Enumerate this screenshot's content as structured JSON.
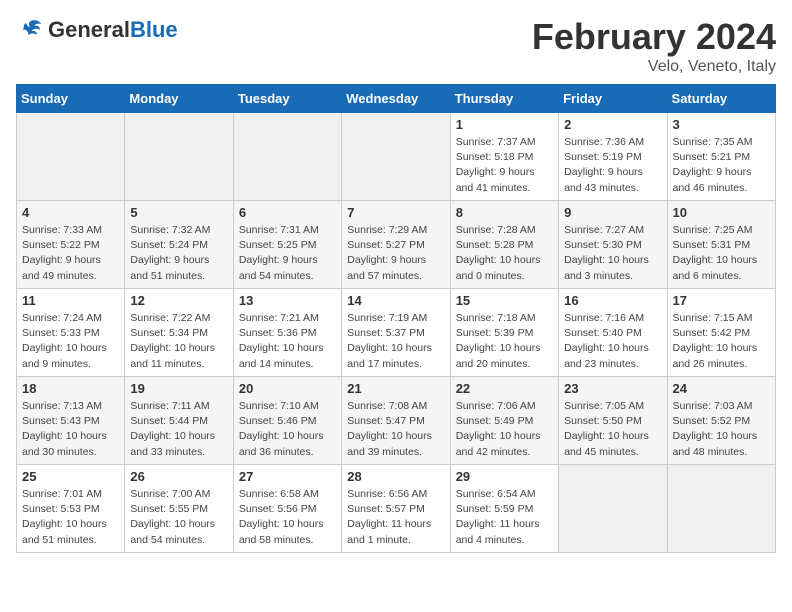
{
  "header": {
    "logo_general": "General",
    "logo_blue": "Blue",
    "month_title": "February 2024",
    "subtitle": "Velo, Veneto, Italy"
  },
  "days_of_week": [
    "Sunday",
    "Monday",
    "Tuesday",
    "Wednesday",
    "Thursday",
    "Friday",
    "Saturday"
  ],
  "weeks": [
    [
      {
        "day": "",
        "info": ""
      },
      {
        "day": "",
        "info": ""
      },
      {
        "day": "",
        "info": ""
      },
      {
        "day": "",
        "info": ""
      },
      {
        "day": "1",
        "info": "Sunrise: 7:37 AM\nSunset: 5:18 PM\nDaylight: 9 hours\nand 41 minutes."
      },
      {
        "day": "2",
        "info": "Sunrise: 7:36 AM\nSunset: 5:19 PM\nDaylight: 9 hours\nand 43 minutes."
      },
      {
        "day": "3",
        "info": "Sunrise: 7:35 AM\nSunset: 5:21 PM\nDaylight: 9 hours\nand 46 minutes."
      }
    ],
    [
      {
        "day": "4",
        "info": "Sunrise: 7:33 AM\nSunset: 5:22 PM\nDaylight: 9 hours\nand 49 minutes."
      },
      {
        "day": "5",
        "info": "Sunrise: 7:32 AM\nSunset: 5:24 PM\nDaylight: 9 hours\nand 51 minutes."
      },
      {
        "day": "6",
        "info": "Sunrise: 7:31 AM\nSunset: 5:25 PM\nDaylight: 9 hours\nand 54 minutes."
      },
      {
        "day": "7",
        "info": "Sunrise: 7:29 AM\nSunset: 5:27 PM\nDaylight: 9 hours\nand 57 minutes."
      },
      {
        "day": "8",
        "info": "Sunrise: 7:28 AM\nSunset: 5:28 PM\nDaylight: 10 hours\nand 0 minutes."
      },
      {
        "day": "9",
        "info": "Sunrise: 7:27 AM\nSunset: 5:30 PM\nDaylight: 10 hours\nand 3 minutes."
      },
      {
        "day": "10",
        "info": "Sunrise: 7:25 AM\nSunset: 5:31 PM\nDaylight: 10 hours\nand 6 minutes."
      }
    ],
    [
      {
        "day": "11",
        "info": "Sunrise: 7:24 AM\nSunset: 5:33 PM\nDaylight: 10 hours\nand 9 minutes."
      },
      {
        "day": "12",
        "info": "Sunrise: 7:22 AM\nSunset: 5:34 PM\nDaylight: 10 hours\nand 11 minutes."
      },
      {
        "day": "13",
        "info": "Sunrise: 7:21 AM\nSunset: 5:36 PM\nDaylight: 10 hours\nand 14 minutes."
      },
      {
        "day": "14",
        "info": "Sunrise: 7:19 AM\nSunset: 5:37 PM\nDaylight: 10 hours\nand 17 minutes."
      },
      {
        "day": "15",
        "info": "Sunrise: 7:18 AM\nSunset: 5:39 PM\nDaylight: 10 hours\nand 20 minutes."
      },
      {
        "day": "16",
        "info": "Sunrise: 7:16 AM\nSunset: 5:40 PM\nDaylight: 10 hours\nand 23 minutes."
      },
      {
        "day": "17",
        "info": "Sunrise: 7:15 AM\nSunset: 5:42 PM\nDaylight: 10 hours\nand 26 minutes."
      }
    ],
    [
      {
        "day": "18",
        "info": "Sunrise: 7:13 AM\nSunset: 5:43 PM\nDaylight: 10 hours\nand 30 minutes."
      },
      {
        "day": "19",
        "info": "Sunrise: 7:11 AM\nSunset: 5:44 PM\nDaylight: 10 hours\nand 33 minutes."
      },
      {
        "day": "20",
        "info": "Sunrise: 7:10 AM\nSunset: 5:46 PM\nDaylight: 10 hours\nand 36 minutes."
      },
      {
        "day": "21",
        "info": "Sunrise: 7:08 AM\nSunset: 5:47 PM\nDaylight: 10 hours\nand 39 minutes."
      },
      {
        "day": "22",
        "info": "Sunrise: 7:06 AM\nSunset: 5:49 PM\nDaylight: 10 hours\nand 42 minutes."
      },
      {
        "day": "23",
        "info": "Sunrise: 7:05 AM\nSunset: 5:50 PM\nDaylight: 10 hours\nand 45 minutes."
      },
      {
        "day": "24",
        "info": "Sunrise: 7:03 AM\nSunset: 5:52 PM\nDaylight: 10 hours\nand 48 minutes."
      }
    ],
    [
      {
        "day": "25",
        "info": "Sunrise: 7:01 AM\nSunset: 5:53 PM\nDaylight: 10 hours\nand 51 minutes."
      },
      {
        "day": "26",
        "info": "Sunrise: 7:00 AM\nSunset: 5:55 PM\nDaylight: 10 hours\nand 54 minutes."
      },
      {
        "day": "27",
        "info": "Sunrise: 6:58 AM\nSunset: 5:56 PM\nDaylight: 10 hours\nand 58 minutes."
      },
      {
        "day": "28",
        "info": "Sunrise: 6:56 AM\nSunset: 5:57 PM\nDaylight: 11 hours\nand 1 minute."
      },
      {
        "day": "29",
        "info": "Sunrise: 6:54 AM\nSunset: 5:59 PM\nDaylight: 11 hours\nand 4 minutes."
      },
      {
        "day": "",
        "info": ""
      },
      {
        "day": "",
        "info": ""
      }
    ]
  ]
}
